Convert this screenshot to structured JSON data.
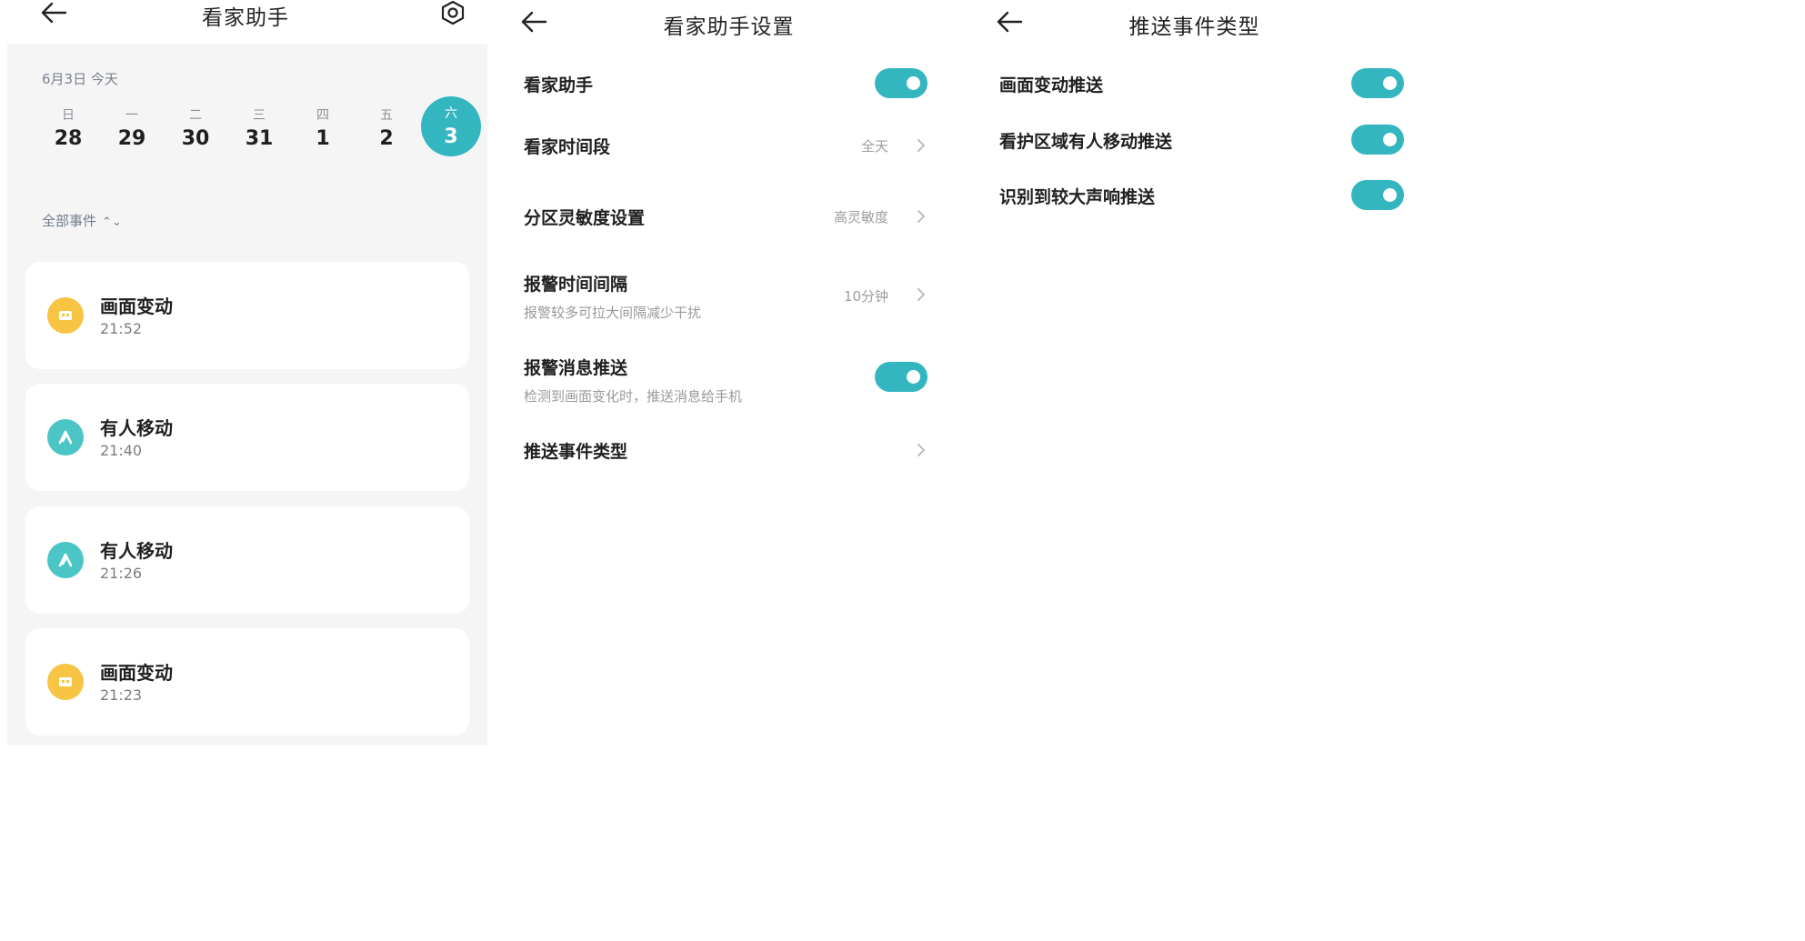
{
  "colors": {
    "accent": "#33b6c0",
    "event_yellow": "#f7c443",
    "event_teal": "#4cc5c7",
    "page_bg": "#f5f5f5"
  },
  "panel_a": {
    "title": "看家助手",
    "date_caption": "6月3日 今天",
    "week": [
      {
        "dow": "日",
        "num": "28",
        "selected": false
      },
      {
        "dow": "一",
        "num": "29",
        "selected": false
      },
      {
        "dow": "二",
        "num": "30",
        "selected": false
      },
      {
        "dow": "三",
        "num": "31",
        "selected": false
      },
      {
        "dow": "四",
        "num": "1",
        "selected": false
      },
      {
        "dow": "五",
        "num": "2",
        "selected": false
      },
      {
        "dow": "六",
        "num": "3",
        "selected": true
      }
    ],
    "filter_label": "全部事件",
    "events": [
      {
        "title": "画面变动",
        "time": "21:52",
        "icon": "screen-change-icon",
        "color": "#f7c443"
      },
      {
        "title": "有人移动",
        "time": "21:40",
        "icon": "person-moving-icon",
        "color": "#4cc5c7"
      },
      {
        "title": "有人移动",
        "time": "21:26",
        "icon": "person-moving-icon",
        "color": "#4cc5c7"
      },
      {
        "title": "画面变动",
        "time": "21:23",
        "icon": "screen-change-icon",
        "color": "#f7c443"
      }
    ]
  },
  "panel_b": {
    "title": "看家助手设置",
    "items": [
      {
        "label": "看家助手",
        "control": "toggle",
        "on": true
      },
      {
        "label": "看家时间段",
        "value": "全天",
        "control": "chevron"
      },
      {
        "label": "分区灵敏度设置",
        "value": "高灵敏度",
        "control": "chevron"
      },
      {
        "label": "报警时间间隔",
        "desc": "报警较多可拉大间隔减少干扰",
        "value": "10分钟",
        "control": "chevron"
      },
      {
        "label": "报警消息推送",
        "desc": "检测到画面变化时，推送消息给手机",
        "control": "toggle",
        "on": true
      },
      {
        "label": "推送事件类型",
        "control": "chevron"
      }
    ]
  },
  "panel_c": {
    "title": "推送事件类型",
    "items": [
      {
        "label": "画面变动推送",
        "on": true
      },
      {
        "label": "看护区域有人移动推送",
        "on": true
      },
      {
        "label": "识别到较大声响推送",
        "on": true
      }
    ]
  }
}
